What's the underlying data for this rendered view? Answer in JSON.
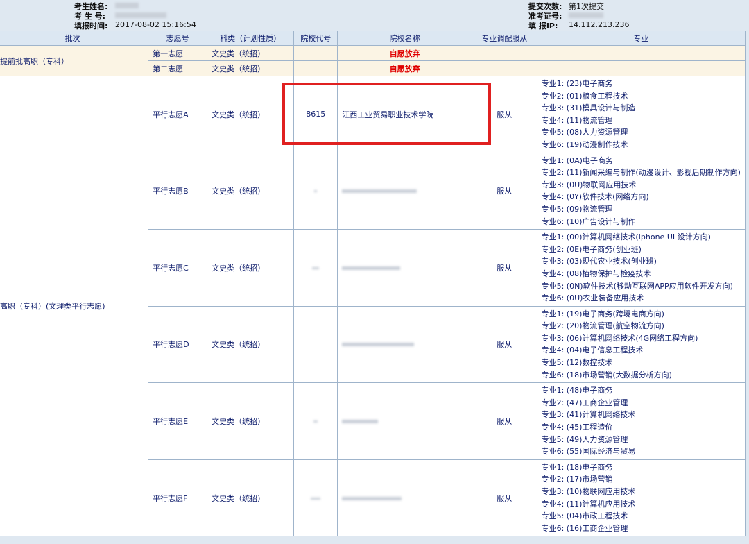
{
  "header": {
    "name_label": "考生姓名:",
    "id_label": "考 生 号:",
    "time_label": "填报时间:",
    "time_value": "2017-08-02 15:16:54",
    "submit_label": "提交次数:",
    "submit_value": "第1次提交",
    "ticket_label": "准考证号:",
    "ip_label": "填 报IP:",
    "ip_value": "14.112.213.236"
  },
  "columns": [
    "批次",
    "志愿号",
    "科类（计划性质）",
    "院校代号",
    "院校名称",
    "专业调配服从",
    "专业"
  ],
  "early_batch": {
    "batch": "提前批高职（专科）",
    "rows": [
      {
        "choice": "第一志愿",
        "category": "文史类（统招）",
        "school_name": "自愿放弃"
      },
      {
        "choice": "第二志愿",
        "category": "文史类（统招）",
        "school_name": "自愿放弃"
      }
    ]
  },
  "main_batch": {
    "batch": "高职（专科）(文理类平行志愿)",
    "rows": [
      {
        "choice": "平行志愿A",
        "category": "文史类（统招）",
        "code": "8615",
        "school": "江西工业贸易职业技术学院",
        "obey": "服从",
        "majors": [
          "专业1: (23)电子商务",
          "专业2: (01)粮食工程技术",
          "专业3: (31)模具设计与制造",
          "专业4: (11)物流管理",
          "专业5: (08)人力资源管理",
          "专业6: (19)动漫制作技术"
        ]
      },
      {
        "choice": "平行志愿B",
        "category": "文史类（统招）",
        "code": "",
        "school": "",
        "obey": "服从",
        "majors": [
          "专业1: (0A)电子商务",
          "专业2: (11)新闻采编与制作(动漫设计、影视后期制作方向)",
          "专业3: (0U)物联网应用技术",
          "专业4: (0Y)软件技术(网络方向)",
          "专业5: (09)物流管理",
          "专业6: (10)广告设计与制作"
        ]
      },
      {
        "choice": "平行志愿C",
        "category": "文史类（统招）",
        "code": "",
        "school": "",
        "obey": "服从",
        "majors": [
          "专业1: (00)计算机网络技术(Iphone UI 设计方向)",
          "专业2: (0E)电子商务(创业班)",
          "专业3: (03)现代农业技术(创业班)",
          "专业4: (08)植物保护与检疫技术",
          "专业5: (0N)软件技术(移动互联网APP应用软件开发方向)",
          "专业6: (0U)农业装备应用技术"
        ]
      },
      {
        "choice": "平行志愿D",
        "category": "文史类（统招）",
        "code": "",
        "school": "",
        "obey": "服从",
        "majors": [
          "专业1: (19)电子商务(跨境电商方向)",
          "专业2: (20)物流管理(航空物流方向)",
          "专业3: (06)计算机网络技术(4G网络工程方向)",
          "专业4: (04)电子信息工程技术",
          "专业5: (12)数控技术",
          "专业6: (18)市场营销(大数据分析方向)"
        ]
      },
      {
        "choice": "平行志愿E",
        "category": "文史类（统招）",
        "code": "",
        "school": "",
        "obey": "服从",
        "majors": [
          "专业1: (48)电子商务",
          "专业2: (47)工商企业管理",
          "专业3: (41)计算机网络技术",
          "专业4: (45)工程造价",
          "专业5: (49)人力资源管理",
          "专业6: (55)国际经济与贸易"
        ]
      },
      {
        "choice": "平行志愿F",
        "category": "文史类（统招）",
        "code": "",
        "school": "",
        "obey": "服从",
        "majors": [
          "专业1: (18)电子商务",
          "专业2: (17)市场营销",
          "专业3: (10)物联网应用技术",
          "专业4: (11)计算机应用技术",
          "专业5: (04)市政工程技术",
          "专业6: (16)工商企业管理"
        ]
      }
    ]
  },
  "colors": {
    "highlight": "#e02020",
    "header_bg": "#dfe8f1",
    "early_row_bg": "#fbf4e4",
    "text": "#0c1b6b",
    "abandon": "#e00000"
  }
}
